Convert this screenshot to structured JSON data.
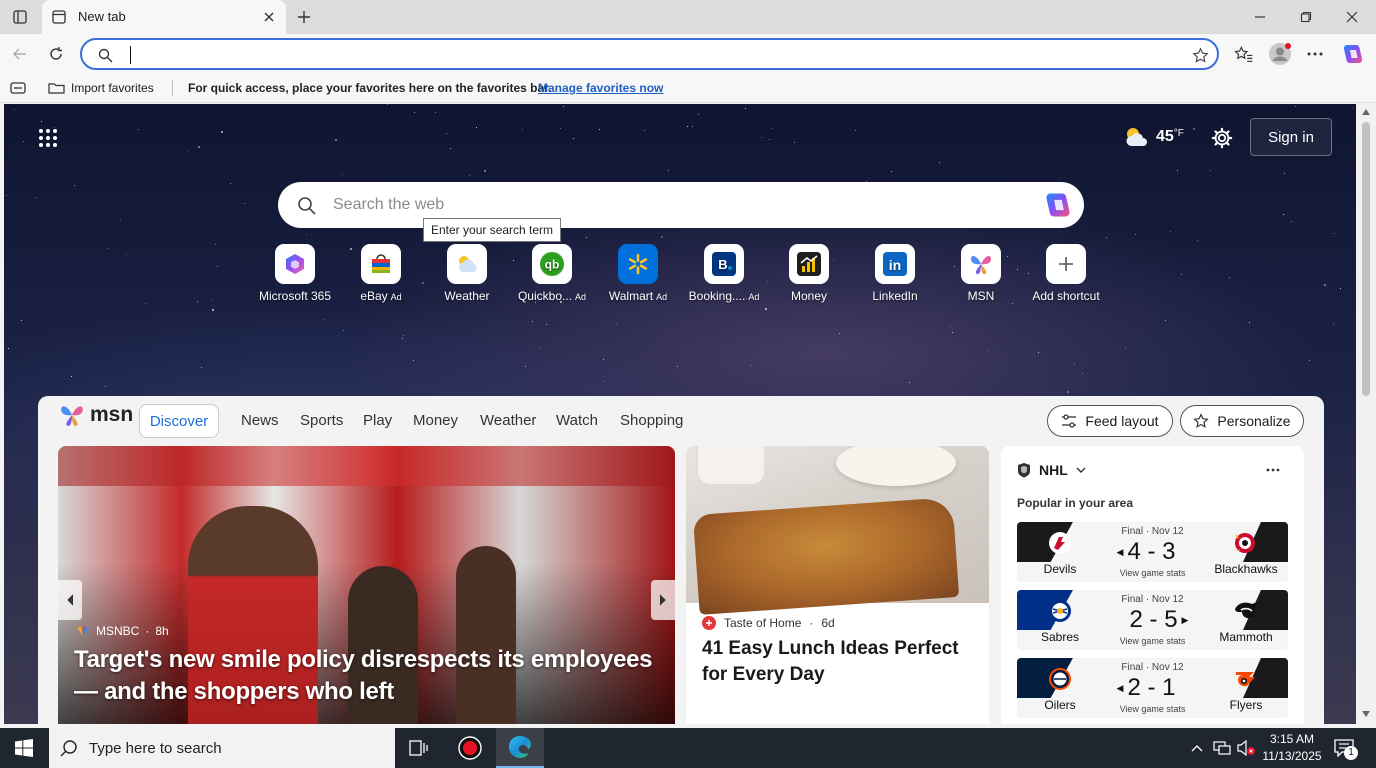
{
  "tab": {
    "title": "New tab"
  },
  "address": {
    "value": ""
  },
  "favbar": {
    "import_label": "Import favorites",
    "message": "For quick access, place your favorites here on the favorites bar.",
    "manage_link": "Manage favorites now"
  },
  "top": {
    "temperature": "45",
    "temp_unit": "°F",
    "sign_in": "Sign in"
  },
  "search": {
    "placeholder": "Search the web",
    "tooltip": "Enter your search term"
  },
  "quicklinks": [
    {
      "label": "Microsoft 365",
      "ad": ""
    },
    {
      "label": "eBay",
      "ad": "Ad"
    },
    {
      "label": "Weather",
      "ad": ""
    },
    {
      "label": "Quickbo...",
      "ad": "Ad"
    },
    {
      "label": "Walmart",
      "ad": "Ad"
    },
    {
      "label": "Booking....",
      "ad": "Ad"
    },
    {
      "label": "Money",
      "ad": ""
    },
    {
      "label": "LinkedIn",
      "ad": ""
    },
    {
      "label": "MSN",
      "ad": ""
    },
    {
      "label": "Add shortcut",
      "ad": ""
    }
  ],
  "feed": {
    "brand": "msn",
    "tabs": [
      "Discover",
      "News",
      "Sports",
      "Play",
      "Money",
      "Weather",
      "Watch",
      "Shopping"
    ],
    "feed_layout": "Feed layout",
    "personalize": "Personalize"
  },
  "story1": {
    "source": "MSNBC",
    "age": "8h",
    "headline": "Target's new smile policy disrespects its employees — and the shoppers who left"
  },
  "story2": {
    "source": "Taste of Home",
    "age": "6d",
    "headline": "41 Easy Lunch Ideas Perfect for Every Day"
  },
  "nhl": {
    "title": "NHL",
    "subtitle": "Popular in your area",
    "stats_label": "View game stats",
    "games": [
      {
        "status": "Final · Nov 12",
        "home": "Devils",
        "away": "Blackhawks",
        "score": "4 - 3",
        "home_color": "#c8102e",
        "away_color": "#1a1a1a"
      },
      {
        "status": "Final · Nov 12",
        "home": "Sabres",
        "away": "Mammoth",
        "score": "2 - 5",
        "home_color": "#003087",
        "away_color": "#1a1a1a"
      },
      {
        "status": "Final · Nov 12",
        "home": "Oilers",
        "away": "Flyers",
        "score": "2 - 1",
        "home_color": "#041e42",
        "away_color": "#1a1a1a"
      }
    ]
  },
  "taskbar": {
    "search_placeholder": "Type here to search",
    "time": "3:15 AM",
    "date": "11/13/2025",
    "notifications": "1"
  }
}
